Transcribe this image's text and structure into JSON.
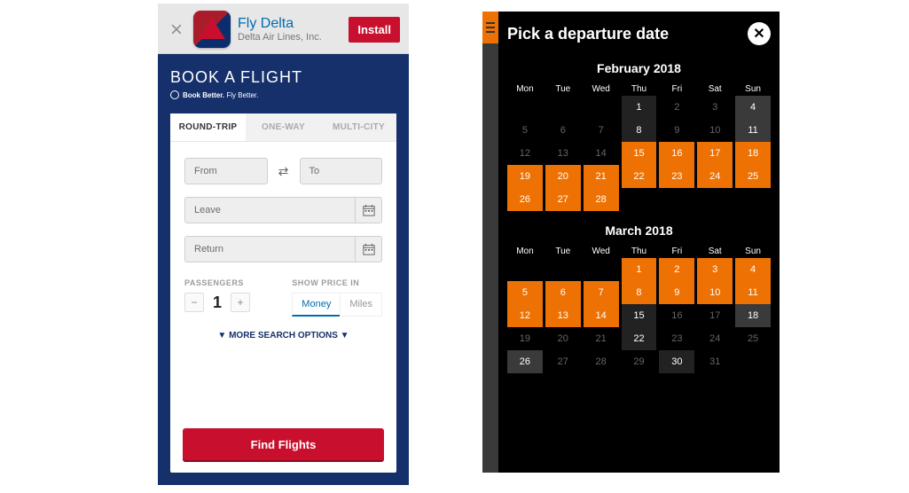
{
  "banner": {
    "title": "Fly Delta",
    "subtitle": "Delta Air Lines, Inc.",
    "install": "Install"
  },
  "booking": {
    "heading": "BOOK A FLIGHT",
    "tagline_bold": "Book Better.",
    "tagline_rest": " Fly Better.",
    "tabs": [
      "ROUND-TRIP",
      "ONE-WAY",
      "MULTI-CITY"
    ],
    "from_ph": "From",
    "to_ph": "To",
    "leave_ph": "Leave",
    "return_ph": "Return",
    "passengers_label": "PASSENGERS",
    "passenger_count": "1",
    "price_label": "SHOW PRICE IN",
    "price_tabs": [
      "Money",
      "Miles"
    ],
    "more": "▼ MORE SEARCH OPTIONS ▼",
    "find": "Find Flights"
  },
  "picker": {
    "title": "Pick a departure date",
    "months": [
      {
        "name": "February 2018",
        "weekdays": [
          "Mon",
          "Tue",
          "Wed",
          "Thu",
          "Fri",
          "Sat",
          "Sun"
        ],
        "rows": [
          [
            {
              "t": "",
              "c": "empty"
            },
            {
              "t": "",
              "c": "empty"
            },
            {
              "t": "",
              "c": "empty"
            },
            {
              "t": "1",
              "c": "dark"
            },
            {
              "t": "2",
              "c": "light"
            },
            {
              "t": "3",
              "c": "light"
            },
            {
              "t": "4",
              "c": "grey"
            }
          ],
          [
            {
              "t": "5",
              "c": "light"
            },
            {
              "t": "6",
              "c": "light"
            },
            {
              "t": "7",
              "c": "light"
            },
            {
              "t": "8",
              "c": "dark"
            },
            {
              "t": "9",
              "c": "light"
            },
            {
              "t": "10",
              "c": "light"
            },
            {
              "t": "11",
              "c": "grey"
            }
          ],
          [
            {
              "t": "12",
              "c": "light"
            },
            {
              "t": "13",
              "c": "light"
            },
            {
              "t": "14",
              "c": "light"
            },
            {
              "t": "15",
              "c": "avail"
            },
            {
              "t": "16",
              "c": "avail"
            },
            {
              "t": "17",
              "c": "avail"
            },
            {
              "t": "18",
              "c": "avail"
            }
          ],
          [
            {
              "t": "19",
              "c": "avail"
            },
            {
              "t": "20",
              "c": "avail"
            },
            {
              "t": "21",
              "c": "avail"
            },
            {
              "t": "22",
              "c": "avail"
            },
            {
              "t": "23",
              "c": "avail"
            },
            {
              "t": "24",
              "c": "avail"
            },
            {
              "t": "25",
              "c": "avail"
            }
          ],
          [
            {
              "t": "26",
              "c": "avail"
            },
            {
              "t": "27",
              "c": "avail"
            },
            {
              "t": "28",
              "c": "avail"
            },
            {
              "t": "",
              "c": "empty"
            },
            {
              "t": "",
              "c": "empty"
            },
            {
              "t": "",
              "c": "empty"
            },
            {
              "t": "",
              "c": "empty"
            }
          ]
        ]
      },
      {
        "name": "March 2018",
        "weekdays": [
          "Mon",
          "Tue",
          "Wed",
          "Thu",
          "Fri",
          "Sat",
          "Sun"
        ],
        "rows": [
          [
            {
              "t": "",
              "c": "empty"
            },
            {
              "t": "",
              "c": "empty"
            },
            {
              "t": "",
              "c": "empty"
            },
            {
              "t": "1",
              "c": "avail"
            },
            {
              "t": "2",
              "c": "avail"
            },
            {
              "t": "3",
              "c": "avail"
            },
            {
              "t": "4",
              "c": "avail"
            }
          ],
          [
            {
              "t": "5",
              "c": "avail"
            },
            {
              "t": "6",
              "c": "avail"
            },
            {
              "t": "7",
              "c": "avail"
            },
            {
              "t": "8",
              "c": "avail"
            },
            {
              "t": "9",
              "c": "avail"
            },
            {
              "t": "10",
              "c": "avail"
            },
            {
              "t": "11",
              "c": "avail"
            }
          ],
          [
            {
              "t": "12",
              "c": "avail"
            },
            {
              "t": "13",
              "c": "avail"
            },
            {
              "t": "14",
              "c": "avail"
            },
            {
              "t": "15",
              "c": "dark"
            },
            {
              "t": "16",
              "c": "light"
            },
            {
              "t": "17",
              "c": "light"
            },
            {
              "t": "18",
              "c": "grey"
            }
          ],
          [
            {
              "t": "19",
              "c": "light"
            },
            {
              "t": "20",
              "c": "light"
            },
            {
              "t": "21",
              "c": "light"
            },
            {
              "t": "22",
              "c": "dark"
            },
            {
              "t": "23",
              "c": "light"
            },
            {
              "t": "24",
              "c": "light"
            },
            {
              "t": "25",
              "c": "light"
            }
          ],
          [
            {
              "t": "26",
              "c": "grey"
            },
            {
              "t": "27",
              "c": "light"
            },
            {
              "t": "28",
              "c": "light"
            },
            {
              "t": "29",
              "c": "light"
            },
            {
              "t": "30",
              "c": "dark"
            },
            {
              "t": "31",
              "c": "light"
            },
            {
              "t": "",
              "c": "empty"
            }
          ]
        ]
      }
    ]
  }
}
